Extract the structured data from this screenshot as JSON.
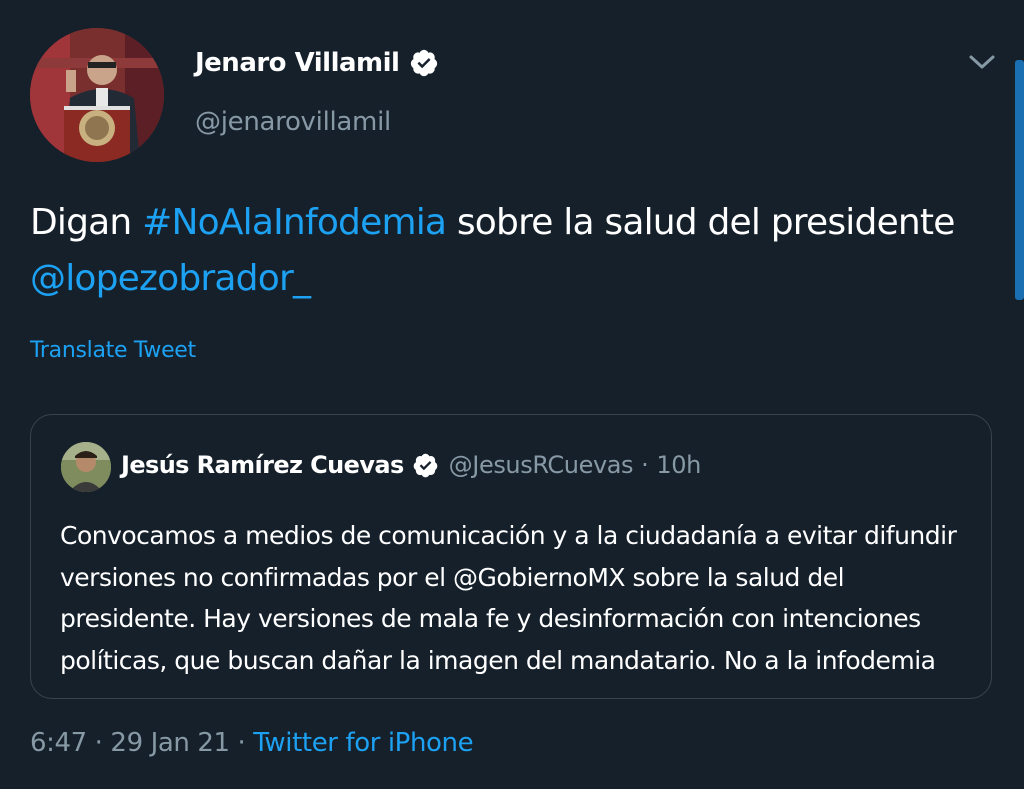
{
  "tweet": {
    "author_name": "Jenaro Villamil",
    "author_handle": "@jenarovillamil",
    "text_prefix": "Digan ",
    "hashtag": "#NoAlaInfodemia",
    "text_middle": " sobre la salud del presidente ",
    "mention": "@lopezobrador_",
    "translate_label": "Translate Tweet",
    "time": "6:47",
    "separator": "·",
    "date": "29 Jan 21",
    "source": "Twitter for iPhone",
    "menu_icon": "chevron-down-icon",
    "verified_icon": "verified-badge-icon"
  },
  "quoted": {
    "author_name": "Jesús Ramírez Cuevas",
    "author_handle": "@JesusRCuevas",
    "separator": "·",
    "time": "10h",
    "text": "Convocamos a medios de comunicación y a la ciudadanía a evitar difundir versiones no confirmadas por el @GobiernoMX sobre la salud del presidente. Hay versiones de mala fe y desinformación con intenciones políticas, que buscan dañar la imagen del mandatario. No a la infodemia"
  },
  "colors": {
    "background": "#15202b",
    "text": "#ffffff",
    "muted": "#8899a6",
    "accent": "#1da1f2",
    "border": "#38444d"
  }
}
